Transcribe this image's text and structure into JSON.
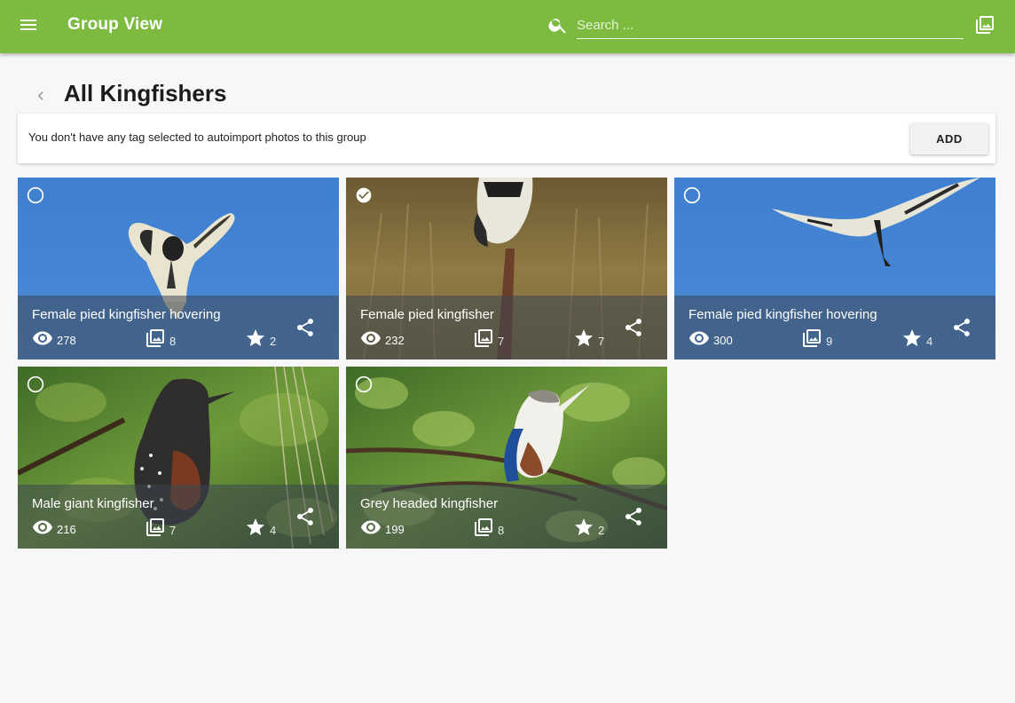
{
  "app": {
    "title": "Group View",
    "search_placeholder": "Search ...",
    "accent": "#7cbb3f"
  },
  "page": {
    "title": "All Kingfishers",
    "info_text": "You don't have any tag selected to autoimport photos to this group",
    "add_label": "ADD"
  },
  "cards": [
    {
      "title": "Female pied kingfisher hovering",
      "views": "278",
      "photos": "8",
      "stars": "2",
      "selected": false
    },
    {
      "title": "Female pied kingfisher",
      "views": "232",
      "photos": "7",
      "stars": "7",
      "selected": true
    },
    {
      "title": "Female pied kingfisher hovering",
      "views": "300",
      "photos": "9",
      "stars": "4",
      "selected": false
    },
    {
      "title": "Male giant kingfisher",
      "views": "216",
      "photos": "7",
      "stars": "4",
      "selected": false
    },
    {
      "title": "Grey headed kingfisher",
      "views": "199",
      "photos": "8",
      "stars": "2",
      "selected": false
    }
  ],
  "icons": {
    "menu": "menu-icon",
    "search": "search-icon",
    "gallery": "photo-library-icon",
    "back": "chevron-left-icon",
    "views": "eye-icon",
    "photos": "photo-library-icon",
    "stars": "star-icon",
    "share": "share-icon",
    "unselected": "circle-outline-icon",
    "selected": "check-circle-icon"
  }
}
